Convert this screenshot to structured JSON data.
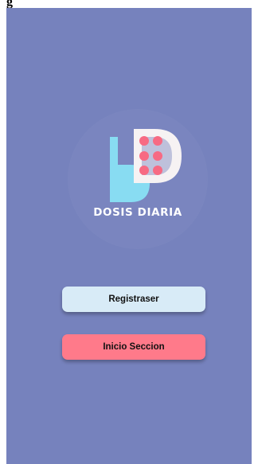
{
  "header_fragment": "g",
  "logo": {
    "text": "DOSIS DIARIA",
    "icon": "pill-letter-d-logo"
  },
  "buttons": {
    "register_label": "Registraser",
    "login_label": "Inicio Seccion"
  },
  "colors": {
    "background": "#7682bd",
    "logo_blue": "#88dcf2",
    "logo_white": "#f6f2f3",
    "logo_pink": "#f76a83",
    "register_button": "#d8ebf7",
    "login_button": "#ff7a8a"
  }
}
